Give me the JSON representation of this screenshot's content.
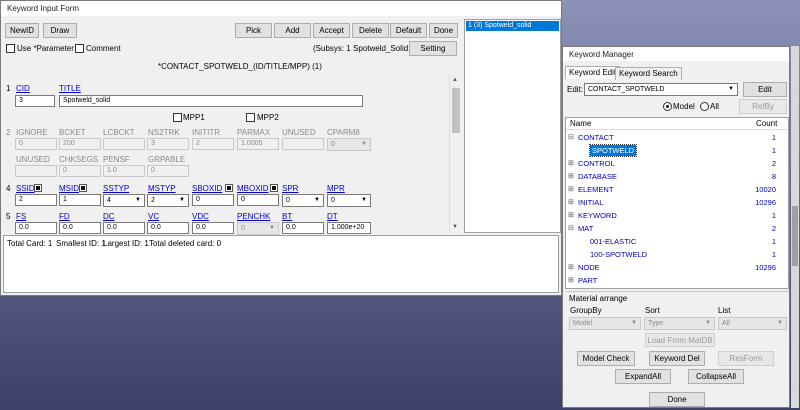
{
  "input_form": {
    "title": "Keyword Input Form",
    "toolbar": {
      "newid": "NewID",
      "draw": "Draw",
      "pick": "Pick",
      "add": "Add",
      "accept": "Accept",
      "delete": "Delete",
      "default": "Default",
      "done": "Done"
    },
    "use_parameter": "Use *Parameter",
    "comment": "Comment",
    "subsys": "(Subsys: 1 Spotweld_Solid.k)",
    "setting": "Setting",
    "heading": "*CONTACT_SPOTWELD_(ID/TITLE/MPP)    (1)",
    "card1": {
      "num": "1",
      "cid_label": "CID",
      "title_label": "TITLE",
      "cid": "3",
      "title": "Spotweld_solid"
    },
    "mpp1": "MPP1",
    "mpp2": "MPP2",
    "card2": {
      "num": "2",
      "labels": [
        "IGNORE",
        "BCKET",
        "LCBCKT",
        "NS2TRK",
        "INITITR",
        "PARMAX",
        "UNUSED",
        "CPARM8"
      ],
      "values": [
        "0",
        "200",
        "",
        "3",
        "2",
        "1.0005",
        "",
        "0"
      ]
    },
    "card3": {
      "labels": [
        "UNUSED",
        "CHKSEGS",
        "PENSF",
        "GRPABLE"
      ],
      "values": [
        "",
        "0",
        "1.0",
        "0"
      ]
    },
    "card4": {
      "num": "4",
      "labels": [
        "SSID",
        "MSID",
        "SSTYP",
        "MSTYP",
        "SBOXID",
        "MBOXID",
        "SPR",
        "MPR"
      ],
      "values": [
        "2",
        "1",
        "4",
        "2",
        "0",
        "0",
        "0",
        "0"
      ]
    },
    "card5": {
      "num": "5",
      "labels": [
        "FS",
        "FD",
        "DC",
        "VC",
        "VDC",
        "PENCHK",
        "BT",
        "DT"
      ],
      "values": [
        "0.0",
        "0.0",
        "0.0",
        "0.0",
        "0.0",
        "0",
        "0.0",
        "1.000e+20"
      ]
    },
    "status": {
      "total_card": "Total Card: 1",
      "smallest": "Smallest ID: 1",
      "largest": "Largest ID: 1",
      "deleted": "Total deleted card:  0"
    }
  },
  "id_list": {
    "item": "1   (3) Spotweld_solid"
  },
  "keyword_manager": {
    "title": "Keyword Manager",
    "tabs": [
      "Keyword Edit",
      "Keyword Search"
    ],
    "edit_label": "Edit:",
    "edit_value": "CONTACT_SPOTWELD",
    "edit_btn": "Edit",
    "radio_model": "Model",
    "radio_all": "All",
    "refby": "RefBy",
    "col_name": "Name",
    "col_count": "Count",
    "tree": [
      {
        "exp": "⊟",
        "name": "CONTACT",
        "count": "1",
        "indent": 0
      },
      {
        "exp": "",
        "name": "SPOTWELD",
        "count": "1",
        "indent": 1,
        "selected": true
      },
      {
        "exp": "⊞",
        "name": "CONTROL",
        "count": "2",
        "indent": 0
      },
      {
        "exp": "⊞",
        "name": "DATABASE",
        "count": "8",
        "indent": 0
      },
      {
        "exp": "⊞",
        "name": "ELEMENT",
        "count": "10020",
        "indent": 0
      },
      {
        "exp": "⊞",
        "name": "INITIAL",
        "count": "10296",
        "indent": 0
      },
      {
        "exp": "⊞",
        "name": "KEYWORD",
        "count": "1",
        "indent": 0
      },
      {
        "exp": "⊟",
        "name": "MAT",
        "count": "2",
        "indent": 0
      },
      {
        "exp": "",
        "name": "001-ELASTIC",
        "count": "1",
        "indent": 1
      },
      {
        "exp": "",
        "name": "100-SPOTWELD",
        "count": "1",
        "indent": 1
      },
      {
        "exp": "⊞",
        "name": "NODE",
        "count": "10296",
        "indent": 0
      },
      {
        "exp": "⊞",
        "name": "PART",
        "count": "",
        "indent": 0
      }
    ],
    "material_arrange": "Material arrange",
    "groupby_label": "GroupBy",
    "sort_label": "Sort",
    "list_label": "List",
    "groupby_value": "Model",
    "sort_value": "Type",
    "list_value": "All",
    "load_matdb": "Load From MatDB",
    "model_check": "Model Check",
    "keyword_del": "Keyword Del",
    "resform": "ResForm",
    "expand_all": "ExpandAll",
    "collapse_all": "CollapseAll",
    "done": "Done"
  }
}
